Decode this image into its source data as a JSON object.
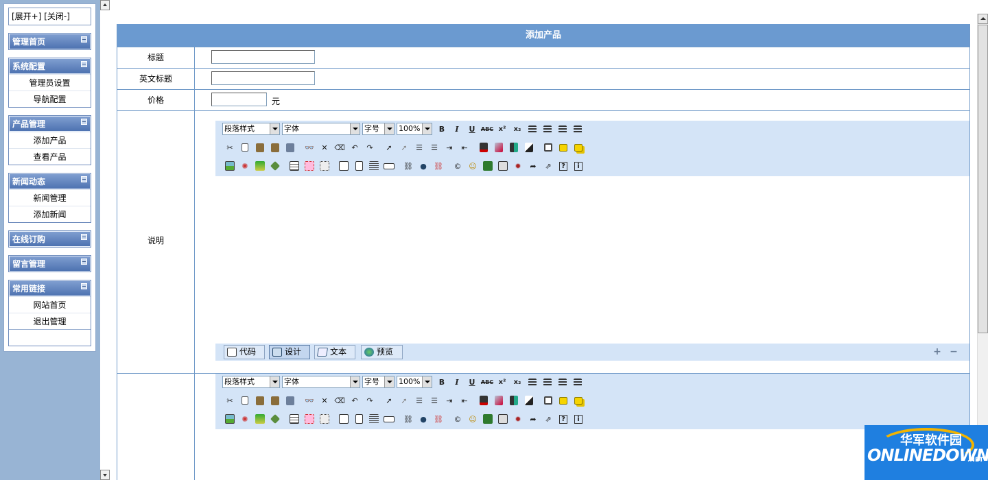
{
  "sidebar": {
    "toggle_label": "[展开+] [关闭-]",
    "groups": [
      {
        "title": "管理首页",
        "items": []
      },
      {
        "title": "系统配置",
        "items": [
          "管理员设置",
          "导航配置"
        ]
      },
      {
        "title": "产品管理",
        "items": [
          "添加产品",
          "查看产品"
        ]
      },
      {
        "title": "新闻动态",
        "items": [
          "新闻管理",
          "添加新闻"
        ]
      },
      {
        "title": "在线订购",
        "items": []
      },
      {
        "title": "留言管理",
        "items": []
      },
      {
        "title": "常用链接",
        "items": [
          "网站首页",
          "退出管理"
        ]
      }
    ]
  },
  "form": {
    "title": "添加产品",
    "fields": {
      "title_label": "标题",
      "title_value": "",
      "en_title_label": "英文标题",
      "en_title_value": "",
      "price_label": "价格",
      "price_value": "",
      "price_unit": "元",
      "desc_label": "说明"
    }
  },
  "editor": {
    "paragraph_style": "段落样式",
    "font": "字体",
    "font_size": "字号",
    "zoom": "100%",
    "bold": "B",
    "italic": "I",
    "underline": "U",
    "strike": "ABC",
    "superscript": "x²",
    "subscript": "x₂",
    "modes": {
      "code": "代码",
      "design": "设计",
      "text": "文本",
      "preview": "预览"
    },
    "active_mode": "设计",
    "expand_symbol": "+",
    "shrink_symbol": "−"
  },
  "watermark": {
    "cn": "华军软件园",
    "en": "ONLINEDOWN",
    "suffix": ".NET"
  },
  "colors": {
    "sidebar_bg": "#98b4d4",
    "header_bg": "#6b9ad0",
    "toolbar_bg": "#d4e4f7",
    "border": "#6f99c8"
  }
}
